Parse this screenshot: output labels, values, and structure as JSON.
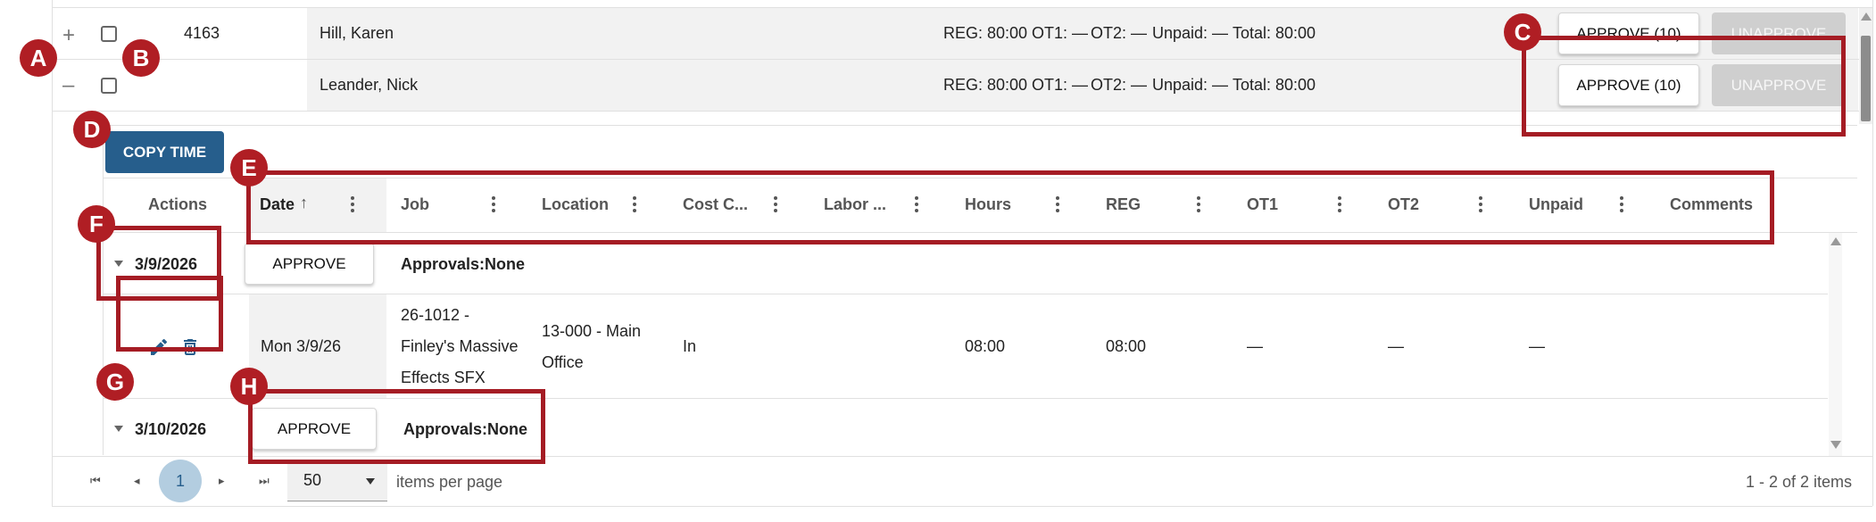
{
  "employees": [
    {
      "expand": "+",
      "number": "4163",
      "name": "Hill, Karen",
      "reg": "REG: 80:00",
      "ot1": "OT1: —",
      "ot2": "OT2: —",
      "unpaid": "Unpaid: —",
      "total": "Total: 80:00",
      "approve": "APPROVE (10)",
      "unapprove": "UNAPPROVE"
    },
    {
      "expand": "–",
      "number": "",
      "name": "Leander, Nick",
      "reg": "REG: 80:00",
      "ot1": "OT1: —",
      "ot2": "OT2: —",
      "unpaid": "Unpaid: —",
      "total": "Total: 80:00",
      "approve": "APPROVE (10)",
      "unapprove": "UNAPPROVE"
    }
  ],
  "copy_time": "COPY TIME",
  "columns": {
    "actions": "Actions",
    "date": "Date",
    "job": "Job",
    "location": "Location",
    "cost_code": "Cost C...",
    "labor": "Labor ...",
    "hours": "Hours",
    "reg": "REG",
    "ot1": "OT1",
    "ot2": "OT2",
    "unpaid": "Unpaid",
    "comments": "Comments"
  },
  "groups": [
    {
      "date": "3/9/2026",
      "approve": "APPROVE",
      "approvals_label": "Approvals:",
      "approvals_value": "None"
    },
    {
      "date": "3/10/2026",
      "approve": "APPROVE",
      "approvals_label": "Approvals:",
      "approvals_value": "None"
    }
  ],
  "entry": {
    "date": "Mon 3/9/26",
    "job_line1": "26-1012 -",
    "job_line2": "Finley's Massive",
    "job_line3": "Effects SFX",
    "location_line1": "13-000 - Main",
    "location_line2": "Office",
    "cost_code": "In",
    "hours": "08:00",
    "reg": "08:00",
    "ot1": "—",
    "ot2": "—",
    "unpaid": "—"
  },
  "pager": {
    "page": "1",
    "per_page": "50",
    "per_page_label": "items per page",
    "summary": "1 - 2 of 2 items"
  },
  "markers": [
    "A",
    "B",
    "C",
    "D",
    "E",
    "F",
    "G",
    "H"
  ],
  "colors": {
    "annotation": "#a51c24",
    "primary_button": "#265e8c",
    "row_bg": "#f2f2f2"
  }
}
